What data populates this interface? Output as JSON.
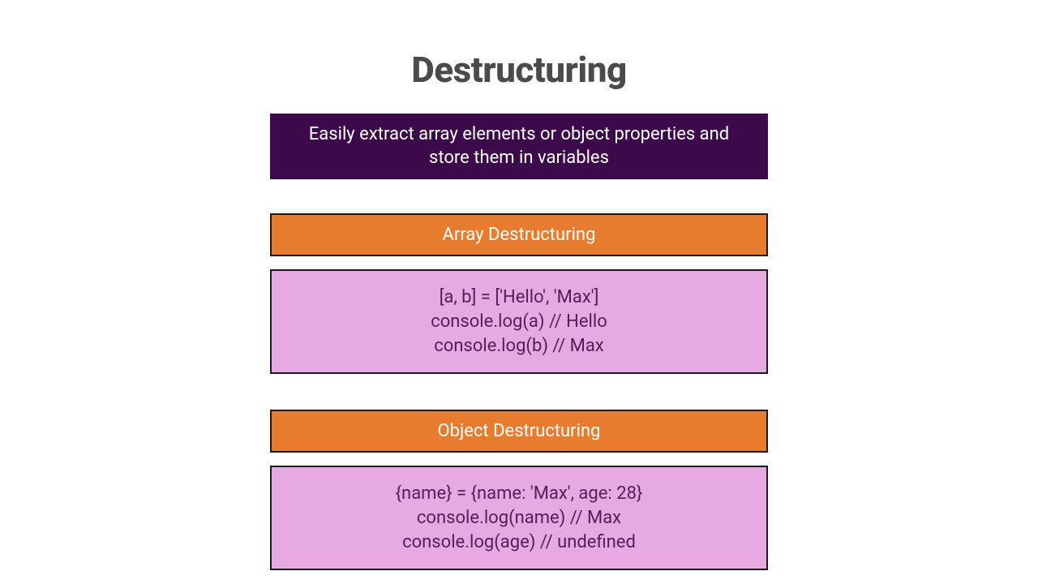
{
  "title": "Destructuring",
  "intro": "Easily extract array elements or object properties and store them in variables",
  "sections": [
    {
      "header": "Array Destructuring",
      "lines": [
        "[a, b] = ['Hello', 'Max']",
        "console.log(a) // Hello",
        "console.log(b) // Max"
      ]
    },
    {
      "header": "Object Destructuring",
      "lines": [
        "{name} = {name: 'Max', age: 28}",
        "console.log(name) // Max",
        "console.log(age) // undefined"
      ]
    }
  ]
}
